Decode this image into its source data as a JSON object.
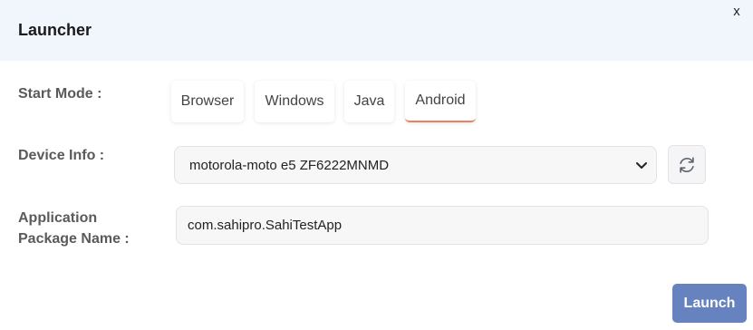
{
  "dialog": {
    "title": "Launcher",
    "close_label": "x"
  },
  "start_mode": {
    "label": "Start Mode :",
    "options": [
      "Browser",
      "Windows",
      "Java",
      "Android"
    ],
    "selected": "Android",
    "accent_color": "#e8825f"
  },
  "device_info": {
    "label": "Device Info :",
    "selected_value": "motorola-moto e5 ZF6222MNMD",
    "refresh_icon": "refresh-icon"
  },
  "app_package": {
    "label_line1": "Application",
    "label_line2": "Package Name :",
    "value": "com.sahipro.SahiTestApp"
  },
  "actions": {
    "launch_label": "Launch",
    "launch_color": "#6683c0"
  }
}
